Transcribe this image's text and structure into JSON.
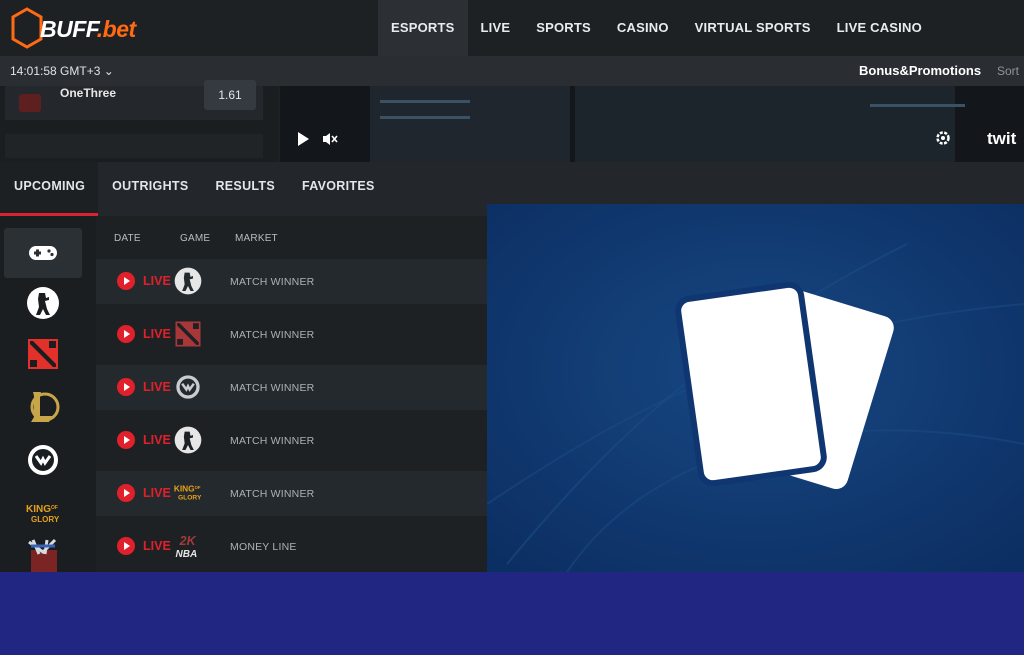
{
  "header": {
    "logo_main": "BUFF",
    "logo_suffix": ".bet",
    "nav": [
      "ESPORTS",
      "LIVE",
      "SPORTS",
      "CASINO",
      "VIRTUAL SPORTS",
      "LIVE CASINO"
    ],
    "active_nav": "ESPORTS"
  },
  "subbar": {
    "clock": "14:01:58 GMT+3 ⌄",
    "promotions": "Bonus&Promotions",
    "sort": "Sort"
  },
  "stream_strip": {
    "team_name": "OneThree",
    "odds": "1.61",
    "twitch_label": "twit"
  },
  "tabs": [
    "UPCOMING",
    "OUTRIGHTS",
    "RESULTS",
    "FAVORITES"
  ],
  "list": {
    "headers": {
      "date": "DATE",
      "game": "GAME",
      "market": "MARKET"
    },
    "rows": [
      {
        "status": "LIVE",
        "game_icon": "counter-strike-icon",
        "market": "MATCH WINNER"
      },
      {
        "status": "LIVE",
        "game_icon": "dota2-icon",
        "market": "MATCH WINNER"
      },
      {
        "status": "LIVE",
        "game_icon": "overwatch-icon",
        "market": "MATCH WINNER"
      },
      {
        "status": "LIVE",
        "game_icon": "counter-strike-icon",
        "market": "MATCH WINNER"
      },
      {
        "status": "LIVE",
        "game_icon": "king-of-glory-icon",
        "market": "MATCH WINNER"
      },
      {
        "status": "LIVE",
        "game_icon": "nba2k-icon",
        "market": "MONEY LINE"
      }
    ]
  },
  "sidebar_icons": [
    "gamepad-icon",
    "counter-strike-icon",
    "dota2-icon",
    "league-of-legends-icon",
    "overwatch-icon",
    "king-of-glory-icon",
    "street-fighter-icon"
  ],
  "icon_text": {
    "king_line1": "KING",
    "king_of": "OF",
    "king_line2": "GLORY",
    "nba_2k": "2K",
    "nba_text": "NBA"
  },
  "colors": {
    "brand_orange": "#ff6a13",
    "live_red": "#e0212c",
    "cards_bg": "#0f3670",
    "bottom_band": "#212683"
  }
}
